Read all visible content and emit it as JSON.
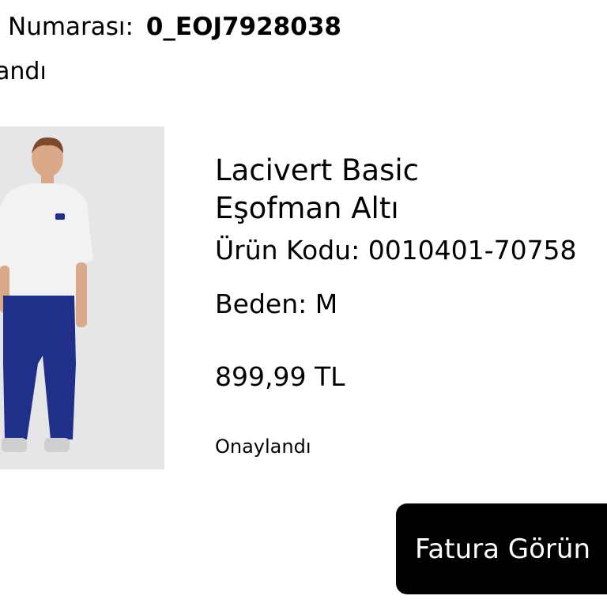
{
  "order": {
    "number_label": "Numarası:",
    "number_value": "0_EOJ7928038",
    "status": "andı"
  },
  "product": {
    "name_line1": "Lacivert Basic",
    "name_line2": "Eşofman Altı",
    "code": "Ürün Kodu: 0010401-70758",
    "size": "Beden: M",
    "price": "899,99 TL",
    "status": "Onaylandı",
    "image_colors": {
      "background": "#e6e6e8",
      "tshirt": "#f2f2f4",
      "pants": "#1f2f8a",
      "skin": "#d9a98a",
      "hair": "#7a4a2a"
    }
  },
  "actions": {
    "invoice_button": "Fatura Görün"
  }
}
